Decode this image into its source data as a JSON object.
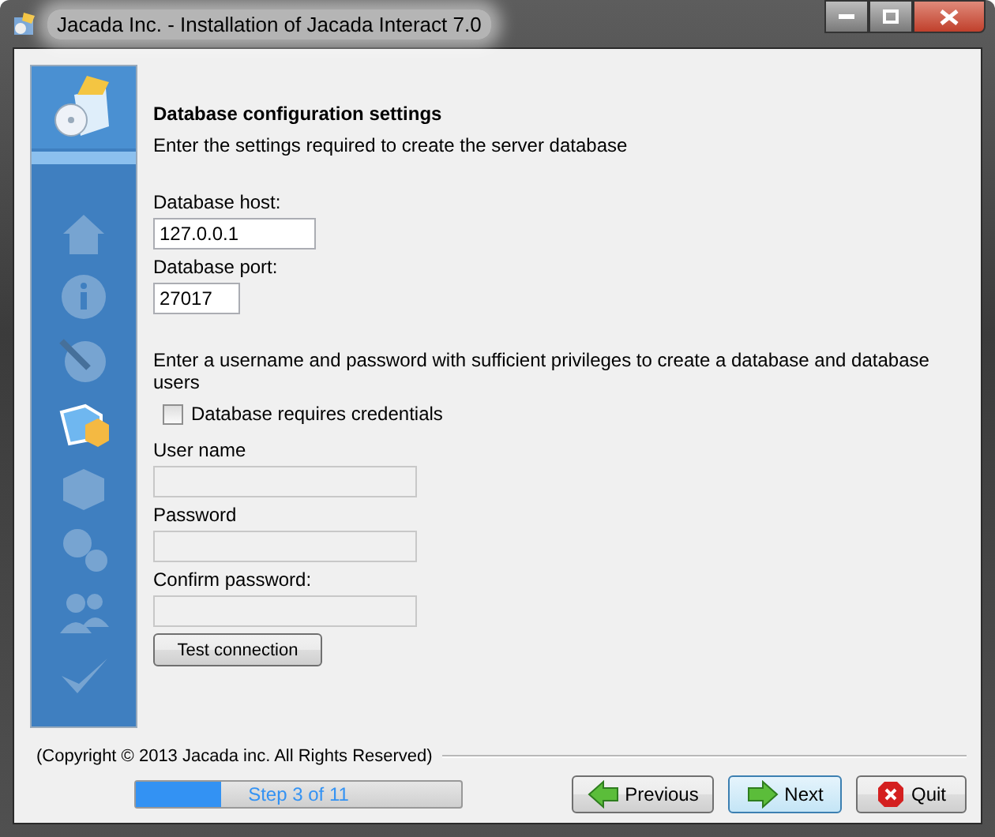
{
  "window": {
    "title": "Jacada Inc. - Installation of Jacada Interact 7.0"
  },
  "steps": [
    {
      "kind": "home",
      "active": false
    },
    {
      "kind": "info",
      "active": false
    },
    {
      "kind": "globe",
      "active": false
    },
    {
      "kind": "database",
      "active": true
    },
    {
      "kind": "box",
      "active": false
    },
    {
      "kind": "gears",
      "active": false
    },
    {
      "kind": "users",
      "active": false
    },
    {
      "kind": "check",
      "active": false
    }
  ],
  "heading": "Database configuration settings",
  "subheading": "Enter the settings required to create the server database",
  "host": {
    "label": "Database host:",
    "value": "127.0.0.1"
  },
  "port": {
    "label": "Database port:",
    "value": "27017"
  },
  "credentials_hint": "Enter a username and password with sufficient privileges to create a database and database users",
  "credentials_checkbox": {
    "label": "Database requires credentials",
    "checked": false
  },
  "credential_fields": [
    {
      "label": "User name",
      "disabled": true
    },
    {
      "label": "Password",
      "disabled": true
    },
    {
      "label": "Confirm password:",
      "disabled": true
    }
  ],
  "test_button": "Test connection",
  "copyright": "(Copyright © 2013 Jacada inc. All Rights Reserved)",
  "progress": {
    "label": "Step 3 of 11",
    "level": 0.26
  },
  "buttons": [
    {
      "kind": "previous",
      "label": "Previous",
      "focused": false
    },
    {
      "kind": "next",
      "label": "Next",
      "focused": true
    },
    {
      "kind": "quit",
      "label": "Quit",
      "focused": false
    }
  ]
}
